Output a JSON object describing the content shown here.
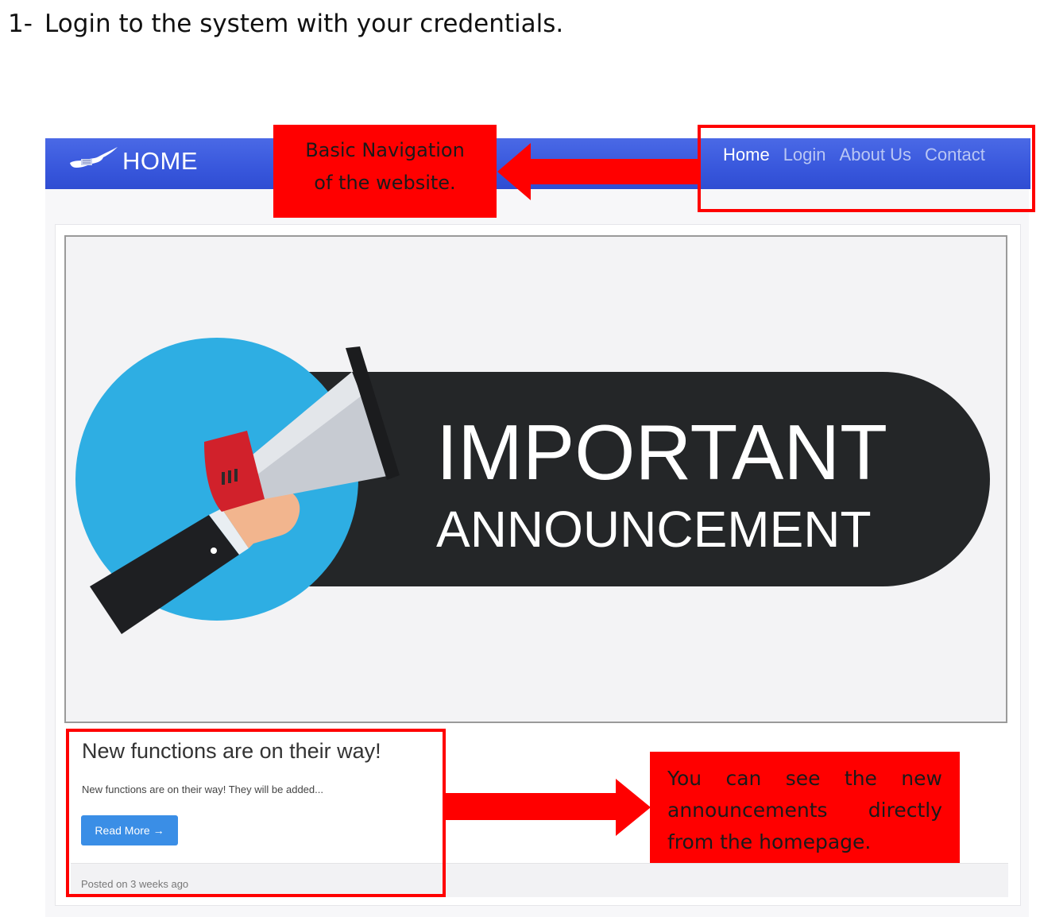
{
  "instruction": {
    "number": "1-",
    "text": "Login to the system with your credentials."
  },
  "navbar": {
    "brand_icon": "cyprus-map-logo-icon",
    "brand_text": "HOME",
    "links": [
      {
        "label": "Home",
        "active": true
      },
      {
        "label": "Login",
        "active": false
      },
      {
        "label": "About Us",
        "active": false
      },
      {
        "label": "Contact",
        "active": false
      }
    ]
  },
  "hero": {
    "icon": "megaphone-icon",
    "line1": "IMPORTANT",
    "line2": "ANNOUNCEMENT"
  },
  "post": {
    "title": "New functions are on their way!",
    "excerpt": "New functions are on their way! They will be added...",
    "read_more": "Read More →",
    "posted": "Posted on 3 weeks ago"
  },
  "annotations": {
    "nav_note": {
      "line1": "Basic Navigation",
      "line2": "of the website."
    },
    "news_note": {
      "line1_words": [
        "You",
        "can",
        "see",
        "the",
        "new"
      ],
      "line2_words": [
        "announcements",
        "directly"
      ],
      "line3": "from the homepage."
    },
    "color": "#ff0000"
  }
}
